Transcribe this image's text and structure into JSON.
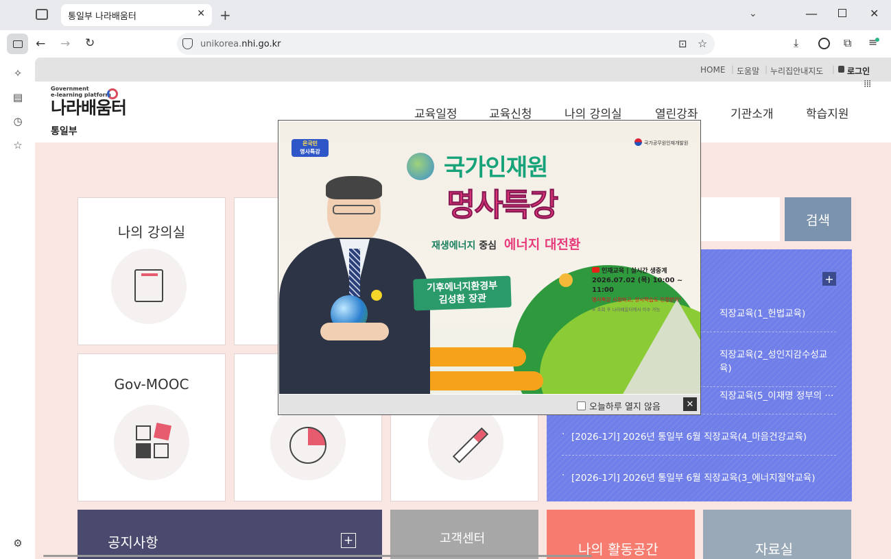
{
  "browser": {
    "tab_title": "통일부 나라배움터",
    "url_host_pre": "unikorea.",
    "url_host_main": "nhi.go.kr"
  },
  "topbar": {
    "home": "HOME",
    "help": "도움말",
    "accessibility": "누리집안내지도",
    "login": "로그인"
  },
  "logo": {
    "line1": "Government",
    "line2": "e-learning platform",
    "name": "나라배움터",
    "ministry": "통일부"
  },
  "gnb": [
    "교육일정",
    "교육신청",
    "나의 강의실",
    "열린강좌",
    "기관소개",
    "학습지원"
  ],
  "cards": {
    "my_classroom": "나의 강의실",
    "gov_mooc": "Gov-MOOC"
  },
  "search": {
    "button": "검색"
  },
  "notices": [
    "직장교육(1_헌법교육)",
    "직장교육(2_성인지감수성교육)",
    "직장교육(5_이재명 정부의 ···",
    "[2026-1기] 2026년 통일부 6월 직장교육(4_마음건강교육)",
    "[2026-1기] 2026년 통일부 6월 직장교육(3_에너지절약교육)"
  ],
  "bottom": {
    "notice": "공지사항",
    "support": "고객센터",
    "activity": "나의 활동공간",
    "library": "자료실"
  },
  "popup": {
    "org": "국가공무원인재개발원",
    "badge_top": "온국민",
    "badge_bottom": "명사특강",
    "title1": "국가인재원",
    "title2": "명사특강",
    "sub_a": "재생에너지",
    "sub_b": "중심",
    "sub_c": "에너지 대전환",
    "speaker_org": "기후에너지환경부",
    "speaker_name": "김성환 장관",
    "live_label": "인재교육 | 실시간 생중계",
    "datetime": "2026.07.02 (목) 10:00 ~ 11:00",
    "note1": "명사특강 시청하고, 상시학습도 인정받자!",
    "note2": "※ 조회 후 나라배움터에서 이수 가능",
    "checkbox_label": "오늘하루 열지 않음",
    "close": "✕"
  },
  "colors": {
    "page_bg": "#f9e5e2",
    "notice_panel": "#6f7ee8",
    "search_btn": "#7b93ad",
    "bottom_notice": "#4a4a6e",
    "bottom_support": "#a7a7a7",
    "bottom_activity": "#f57c6e",
    "bottom_library": "#9aa9b8"
  }
}
